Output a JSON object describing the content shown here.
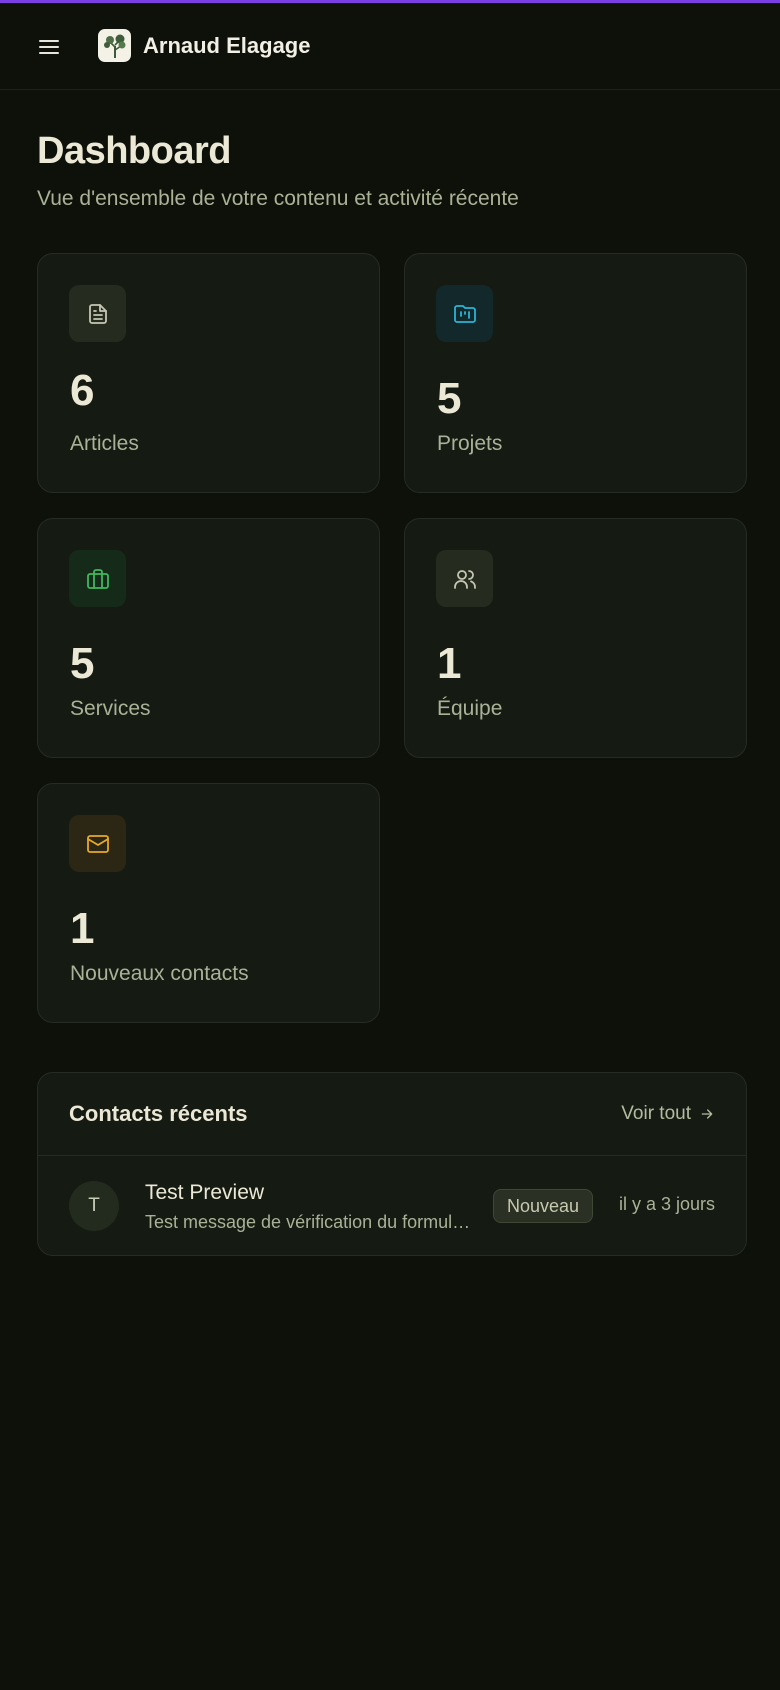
{
  "app": {
    "brand_name": "Arnaud Elagage"
  },
  "page": {
    "title": "Dashboard",
    "subtitle": "Vue d'ensemble de votre contenu et activité récente"
  },
  "stats": [
    {
      "value": "6",
      "label": "Articles",
      "icon": "file-text-icon",
      "color": "#c3c7b2"
    },
    {
      "value": "5",
      "label": "Projets",
      "icon": "folder-kanban-icon",
      "color": "#2bb3d6"
    },
    {
      "value": "5",
      "label": "Services",
      "icon": "briefcase-icon",
      "color": "#3fb85f"
    },
    {
      "value": "1",
      "label": "Équipe",
      "icon": "users-icon",
      "color": "#c3c7b2"
    },
    {
      "value": "1",
      "label": "Nouveaux contacts",
      "icon": "mail-icon",
      "color": "#e6a92a"
    }
  ],
  "recent_contacts": {
    "title": "Contacts récents",
    "see_all": "Voir tout",
    "items": [
      {
        "initial": "T",
        "name": "Test Preview",
        "message": "Test message de vérification du formulaire",
        "badge": "Nouveau",
        "time": "il y a 3 jours"
      }
    ]
  },
  "colors": {
    "background": "#0d110a",
    "card": "#151a12",
    "accent_topline": "#7b3fe4"
  }
}
